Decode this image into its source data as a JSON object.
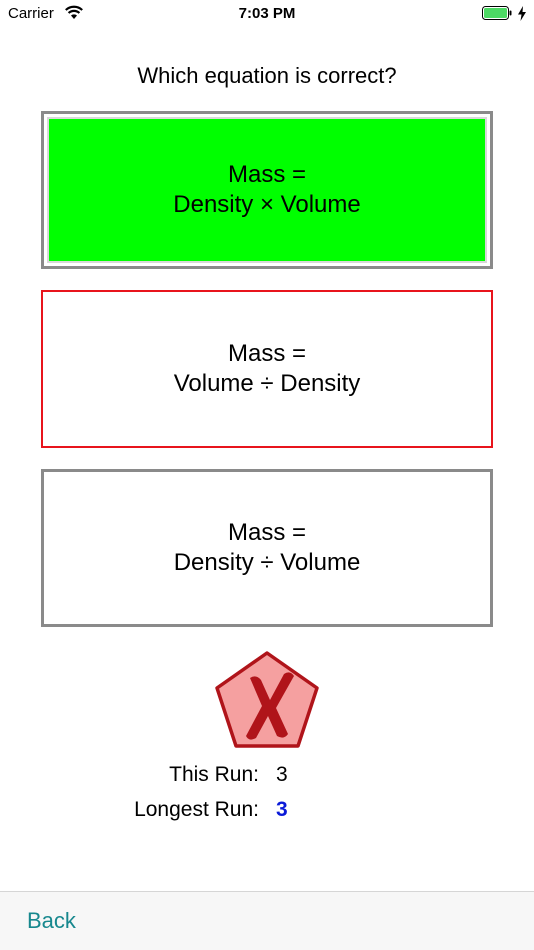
{
  "status_bar": {
    "carrier": "Carrier",
    "time": "7:03 PM"
  },
  "question": "Which equation is correct?",
  "answers": [
    {
      "line1": "Mass =",
      "line2": "Density × Volume",
      "state": "correct",
      "color": "#00ff00"
    },
    {
      "line1": "Mass =",
      "line2": "Volume ÷ Density",
      "state": "wrong",
      "color": "#e8141c"
    },
    {
      "line1": "Mass =",
      "line2": "Density ÷ Volume",
      "state": "neutral",
      "color": "#8a8a8a"
    }
  ],
  "result_icon": "red-pentagon-x-icon",
  "stats": {
    "this_run_label": "This Run:",
    "this_run_value": "3",
    "longest_run_label": "Longest Run:",
    "longest_run_value": "3"
  },
  "toolbar": {
    "back_label": "Back"
  },
  "colors": {
    "accent": "#17888e",
    "highlight_value": "#0a1ad8",
    "correct": "#00ff00",
    "wrong": "#e8141c"
  }
}
